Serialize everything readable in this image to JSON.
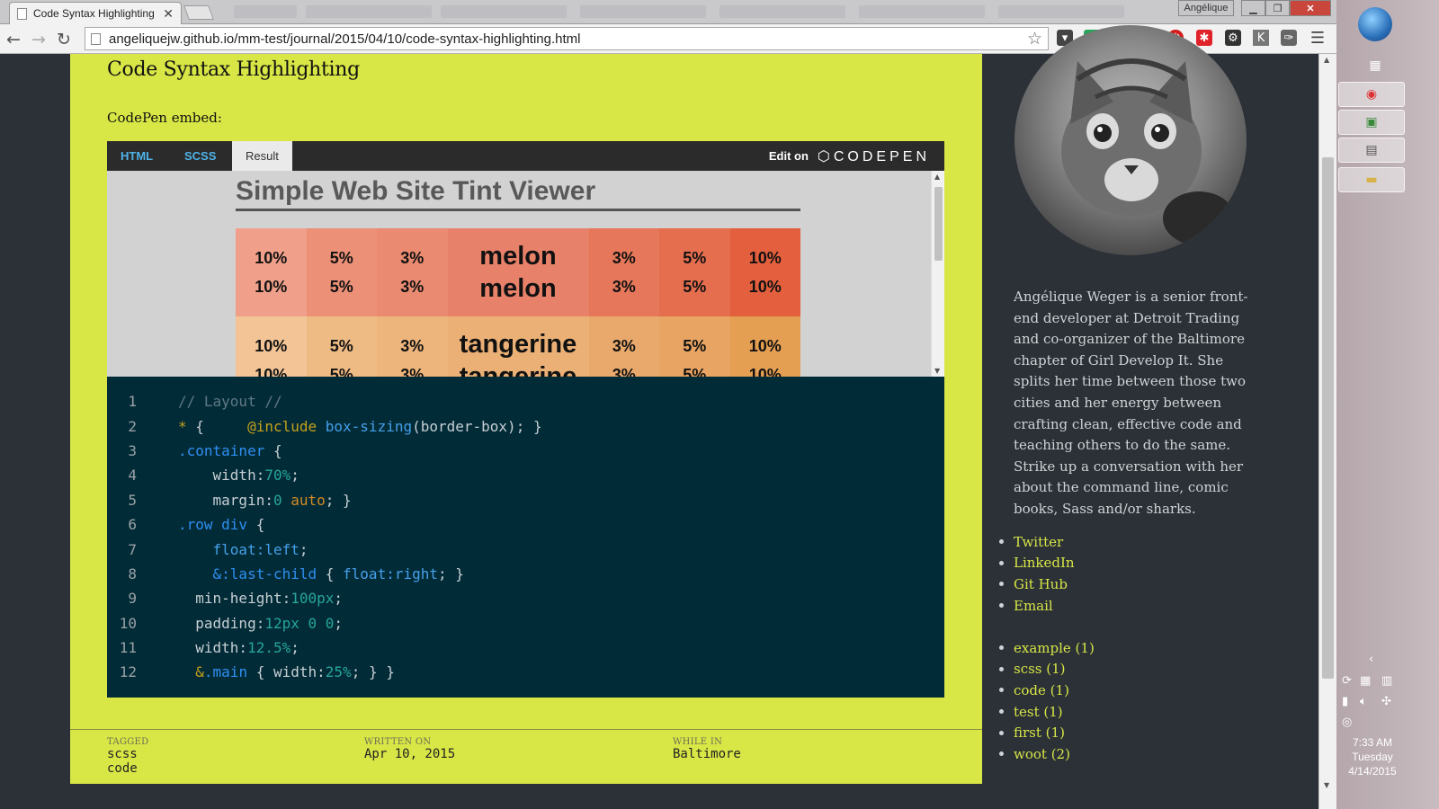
{
  "browser": {
    "tab_title": "Code Syntax Highlighting",
    "url": "angeliquejw.github.io/mm-test/journal/2015/04/10/code-syntax-highlighting.html",
    "window_user": "Angélique"
  },
  "post": {
    "title": "Code Syntax Highlighting",
    "embed_label": "CodePen embed:",
    "codepen": {
      "tabs": [
        "HTML",
        "SCSS",
        "Result"
      ],
      "active_tab": "Result",
      "edit_on": "Edit on",
      "logo": "CODEPEN",
      "demo_title": "Simple Web Site Tint Viewer",
      "rows": [
        {
          "name": "melon",
          "tints": [
            "10%",
            "5%",
            "3%"
          ],
          "shades": [
            "3%",
            "5%",
            "10%"
          ],
          "colors": [
            "#f0a08a",
            "#ec9077",
            "#e98a71",
            "#e8816a",
            "#e7775a",
            "#e56e4f",
            "#e35f3e"
          ]
        },
        {
          "name": "tangerine",
          "tints": [
            "10%",
            "5%",
            "3%"
          ],
          "shades": [
            "3%",
            "5%",
            "10%"
          ],
          "colors": [
            "#f2c496",
            "#efbb85",
            "#edb57c",
            "#ebb075",
            "#e9a96c",
            "#e8a462",
            "#e59f52"
          ]
        }
      ]
    },
    "code_lines": [
      [
        [
          "// Layout //",
          "c-cm"
        ]
      ],
      [
        [
          "* ",
          "c-at"
        ],
        [
          "{     ",
          ""
        ],
        [
          "@include",
          "c-at"
        ],
        [
          " ",
          ""
        ],
        [
          "box-sizing",
          "c-fn"
        ],
        [
          "(border-box); }",
          ""
        ]
      ],
      [
        [
          ".container",
          "c-sel"
        ],
        [
          " {",
          ""
        ]
      ],
      [
        [
          "    width:",
          ""
        ],
        [
          "70%",
          "c-num"
        ],
        [
          ";",
          ""
        ]
      ],
      [
        [
          "    margin:",
          ""
        ],
        [
          "0",
          "c-num"
        ],
        [
          " ",
          ""
        ],
        [
          "auto",
          "c-kw"
        ],
        [
          "; }",
          ""
        ]
      ],
      [
        [
          ".row div",
          "c-sel"
        ],
        [
          " {",
          ""
        ]
      ],
      [
        [
          "    ",
          ""
        ],
        [
          "float:left",
          "c-fn"
        ],
        [
          ";",
          ""
        ]
      ],
      [
        [
          "    ",
          ""
        ],
        [
          "&:last-child",
          "c-sel"
        ],
        [
          " { ",
          ""
        ],
        [
          "float:right",
          "c-fn"
        ],
        [
          "; }",
          ""
        ]
      ],
      [
        [
          "  min-height:",
          ""
        ],
        [
          "100px",
          "c-num"
        ],
        [
          ";",
          ""
        ]
      ],
      [
        [
          "  padding:",
          ""
        ],
        [
          "12px 0 0",
          "c-num"
        ],
        [
          ";",
          ""
        ]
      ],
      [
        [
          "  width:",
          ""
        ],
        [
          "12.5%",
          "c-num"
        ],
        [
          ";",
          ""
        ]
      ],
      [
        [
          "  ",
          ""
        ],
        [
          "&",
          "c-at"
        ],
        [
          ".main",
          "c-sel"
        ],
        [
          " { width:",
          ""
        ],
        [
          "25%",
          "c-num"
        ],
        [
          "; } }",
          ""
        ]
      ]
    ],
    "meta": {
      "tagged_label": "TAGGED",
      "tags": [
        "scss",
        "code"
      ],
      "written_label": "WRITTEN ON",
      "written_value": "Apr 10, 2015",
      "while_label": "WHILE IN",
      "while_value": "Baltimore"
    }
  },
  "sidebar": {
    "bio": "Angélique Weger is a senior front-end developer at Detroit Trading and co-organizer of the Baltimore chapter of Girl Develop It. She splits her time between those two cities and her energy between crafting clean, effective code and teaching others to do the same. Strike up a conversation with her about the command line, comic books, Sass and/or sharks.",
    "social": [
      "Twitter",
      "LinkedIn",
      "Git Hub",
      "Email"
    ],
    "tags": [
      "example (1)",
      "scss (1)",
      "code (1)",
      "test (1)",
      "first (1)",
      "woot (2)"
    ]
  },
  "taskbar": {
    "time": "7:33 AM",
    "day": "Tuesday",
    "date": "4/14/2015"
  },
  "colors": {
    "post_bg": "#d8e646",
    "page_bg": "#2b3137",
    "code_bg": "#022b38",
    "link": "#d8e646"
  }
}
